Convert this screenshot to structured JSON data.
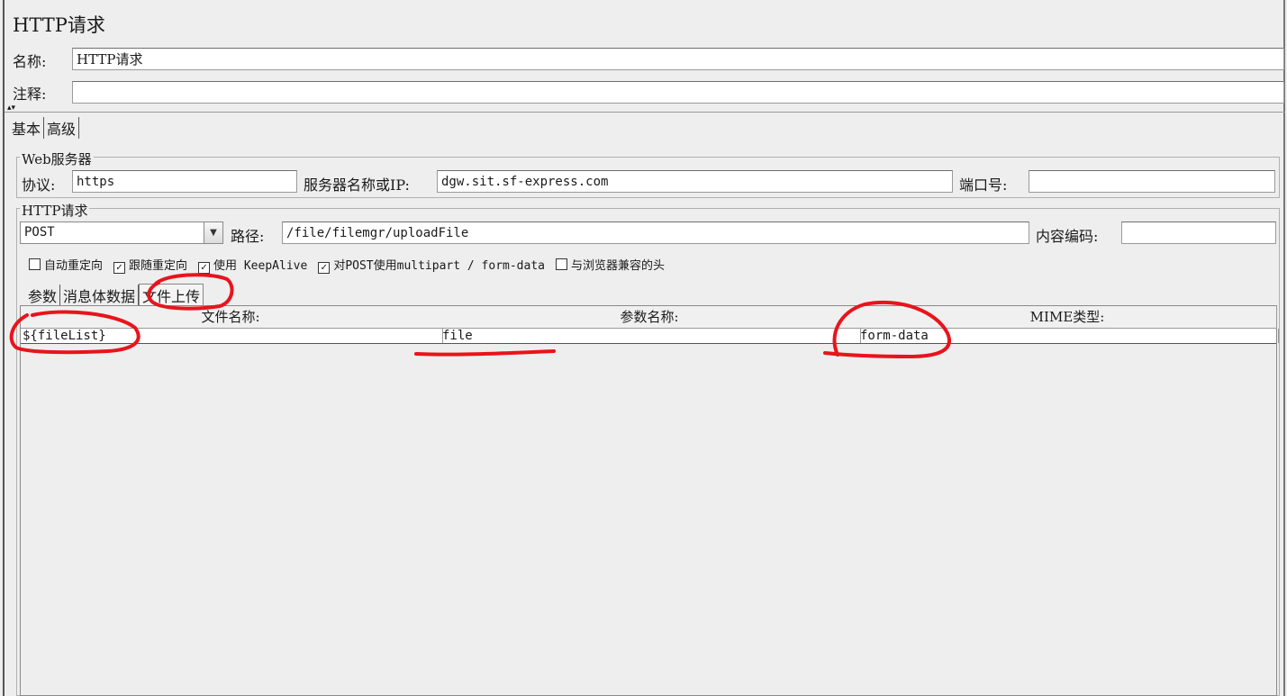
{
  "panel": {
    "title": "HTTP请求"
  },
  "name_field": {
    "label": "名称:",
    "value": "HTTP请求"
  },
  "comment_field": {
    "label": "注释:",
    "value": ""
  },
  "config_tabs": [
    {
      "label": "基本",
      "selected": true
    },
    {
      "label": "高级",
      "selected": false
    }
  ],
  "web_server": {
    "group_label": "Web服务器",
    "protocol_label": "协议:",
    "protocol_value": "https",
    "server_label": "服务器名称或IP:",
    "server_value": "dgw.sit.sf-express.com",
    "port_label": "端口号:",
    "port_value": ""
  },
  "http_request": {
    "group_label": "HTTP请求",
    "method_value": "POST",
    "path_label": "路径:",
    "path_value": "/file/filemgr/uploadFile",
    "encoding_label": "内容编码:",
    "encoding_value": ""
  },
  "options": [
    {
      "label": "自动重定向",
      "checked": false,
      "check_glyph": ""
    },
    {
      "label": "跟随重定向",
      "checked": true,
      "check_glyph": "✓"
    },
    {
      "label": "使用 KeepAlive",
      "checked": true,
      "check_glyph": "✓"
    },
    {
      "label": "对POST使用multipart / form-data",
      "checked": true,
      "check_glyph": "✓"
    },
    {
      "label": "与浏览器兼容的头",
      "checked": false,
      "check_glyph": ""
    }
  ],
  "body_tabs": [
    {
      "label": "参数",
      "selected": false
    },
    {
      "label": "消息体数据",
      "selected": false
    },
    {
      "label": "文件上传",
      "selected": true
    }
  ],
  "files_table": {
    "columns": [
      "文件名称:",
      "参数名称:",
      "MIME类型:"
    ],
    "rows": [
      {
        "file": "${fileList}",
        "param": "file",
        "mime": "form-data"
      }
    ]
  },
  "colors": {
    "background": "#eeeeee",
    "annotation": "#e8141c"
  },
  "annotations": [
    "red-circle-tab",
    "red-circle-filename",
    "red-underline-param",
    "red-circle-mime"
  ]
}
